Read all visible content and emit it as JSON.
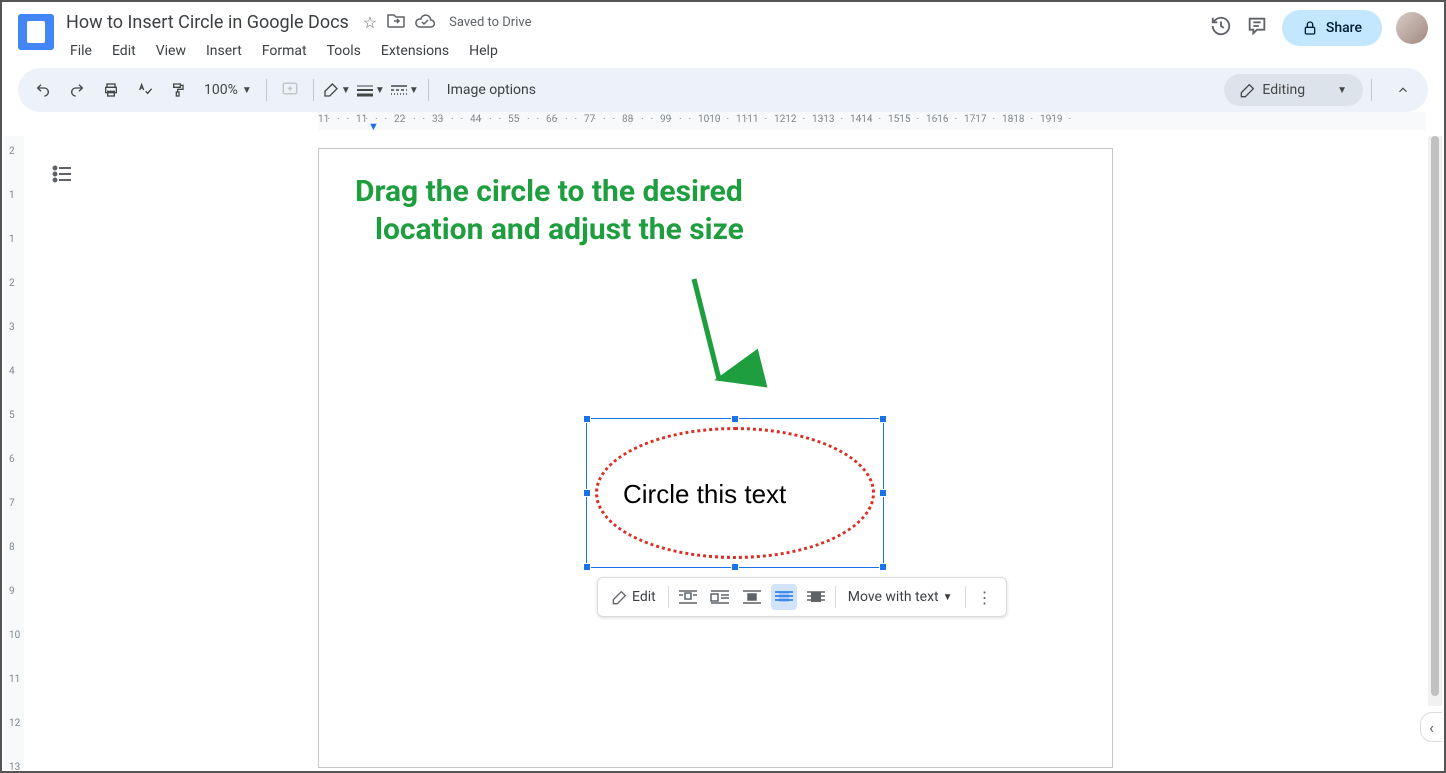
{
  "header": {
    "doc_title": "How to Insert Circle in Google Docs",
    "saved_status": "Saved to Drive",
    "menus": [
      "File",
      "Edit",
      "View",
      "Insert",
      "Format",
      "Tools",
      "Extensions",
      "Help"
    ],
    "share_label": "Share"
  },
  "toolbar": {
    "zoom": "100%",
    "image_options_label": "Image options",
    "mode_label": "Editing"
  },
  "ruler": {
    "h_major": [
      "1",
      "1",
      "2",
      "3",
      "4",
      "5",
      "6",
      "7",
      "8",
      "9",
      "10",
      "11",
      "12",
      "13",
      "14",
      "15",
      "16",
      "17",
      "18",
      "19"
    ],
    "v_major": [
      "2",
      "1",
      "1",
      "2",
      "3",
      "4",
      "5",
      "6",
      "7",
      "8",
      "9",
      "10",
      "11",
      "12",
      "13"
    ]
  },
  "annotation": {
    "line1": "Drag the circle to the desired",
    "line2": "location and adjust the size"
  },
  "selected_image": {
    "text": "Circle this text"
  },
  "float_toolbar": {
    "edit_label": "Edit",
    "move_with_label": "Move with text"
  }
}
